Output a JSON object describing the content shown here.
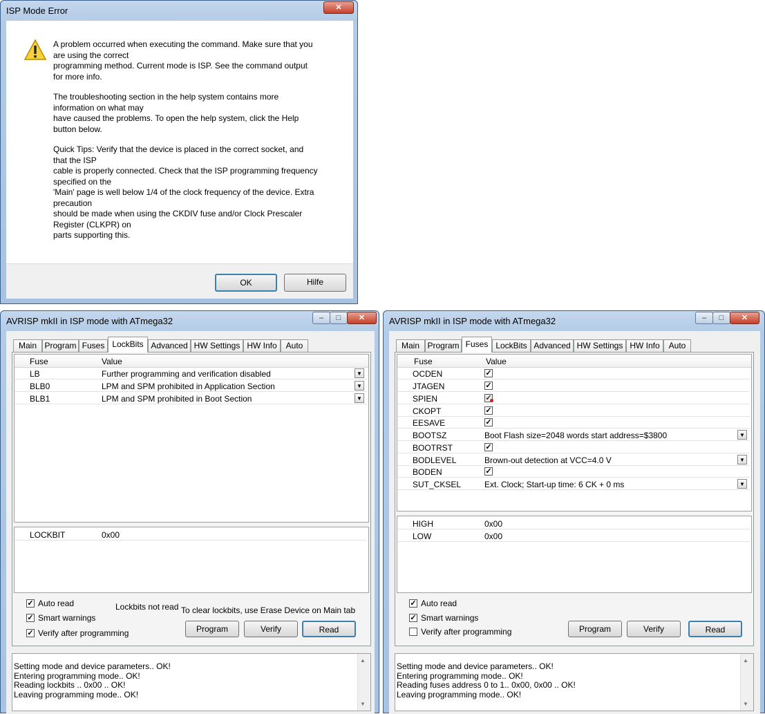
{
  "error_dialog": {
    "title": "ISP Mode Error",
    "close_label": "✕",
    "paragraphs": [
      [
        "A problem occurred when executing the command. Make sure that you",
        "are using the correct",
        "programming method. Current mode is ISP. See the command output",
        "for more info."
      ],
      [
        "The troubleshooting section in the help system contains more",
        "information on what may",
        "have caused the problems. To open the help system, click the Help",
        "button below."
      ],
      [
        "Quick Tips: Verify that the device is placed in the correct socket, and",
        "that the ISP",
        "cable is properly connected. Check that the ISP programming frequency",
        "specified on the",
        "'Main' page is well below 1/4 of the clock frequency of the device. Extra",
        "precaution",
        "should be made when using the CKDIV fuse and/or Clock Prescaler",
        "Register (CLKPR) on",
        "parts supporting this."
      ]
    ],
    "ok_label": "OK",
    "help_label": "Hilfe",
    "icon": "warning-icon"
  },
  "lockbits_window": {
    "title": "AVRISP mkII in ISP mode with ATmega32",
    "tabs": [
      "Main",
      "Program",
      "Fuses",
      "LockBits",
      "Advanced",
      "HW Settings",
      "HW Info",
      "Auto"
    ],
    "active_tab": "LockBits",
    "col_fuse": "Fuse",
    "col_value": "Value",
    "rows": [
      {
        "name": "LB",
        "value": "Further programming and verification disabled"
      },
      {
        "name": "BLB0",
        "value": "LPM and SPM prohibited in Application Section"
      },
      {
        "name": "BLB1",
        "value": "LPM and SPM prohibited in Boot Section"
      }
    ],
    "register": {
      "name": "LOCKBIT",
      "value": "0x00"
    },
    "auto_read": "Auto read",
    "smart_warnings": "Smart warnings",
    "verify_after": "Verify after programming",
    "status_note": "Lockbits not read",
    "clear_note": "To clear lockbits, use Erase Device on Main tab",
    "program": "Program",
    "verify": "Verify",
    "read": "Read",
    "log": [
      "Setting mode and device parameters.. OK!",
      "Entering programming mode.. OK!",
      "Reading lockbits .. 0x00 .. OK!",
      "Leaving programming mode.. OK!"
    ]
  },
  "fuses_window": {
    "title": "AVRISP mkII in ISP mode with ATmega32",
    "tabs": [
      "Main",
      "Program",
      "Fuses",
      "LockBits",
      "Advanced",
      "HW Settings",
      "HW Info",
      "Auto"
    ],
    "active_tab": "Fuses",
    "col_fuse": "Fuse",
    "col_value": "Value",
    "rows": [
      {
        "name": "OCDEN",
        "type": "check"
      },
      {
        "name": "JTAGEN",
        "type": "check"
      },
      {
        "name": "SPIEN",
        "type": "check"
      },
      {
        "name": "CKOPT",
        "type": "check"
      },
      {
        "name": "EESAVE",
        "type": "check"
      },
      {
        "name": "BOOTSZ",
        "type": "select",
        "value": "Boot Flash size=2048 words start address=$3800"
      },
      {
        "name": "BOOTRST",
        "type": "check"
      },
      {
        "name": "BODLEVEL",
        "type": "select",
        "value": "Brown-out detection at VCC=4.0 V"
      },
      {
        "name": "BODEN",
        "type": "check"
      },
      {
        "name": "SUT_CKSEL",
        "type": "select",
        "value": "Ext. Clock; Start-up time: 6 CK + 0 ms"
      }
    ],
    "registers": [
      {
        "name": "HIGH",
        "value": "0x00"
      },
      {
        "name": "LOW",
        "value": "0x00"
      }
    ],
    "auto_read": "Auto read",
    "smart_warnings": "Smart warnings",
    "verify_after": "Verify after programming",
    "program": "Program",
    "verify": "Verify",
    "read": "Read",
    "log": [
      "Setting mode and device parameters.. OK!",
      "Entering programming mode.. OK!",
      "Reading fuses address 0 to 1.. 0x00, 0x00 .. OK!",
      "Leaving programming mode.. OK!"
    ]
  },
  "glyphs": {
    "check": "✓",
    "dropdown": "▼",
    "minimize": "–",
    "maximize": "□",
    "close": "✕",
    "up": "▲",
    "down": "▼"
  }
}
